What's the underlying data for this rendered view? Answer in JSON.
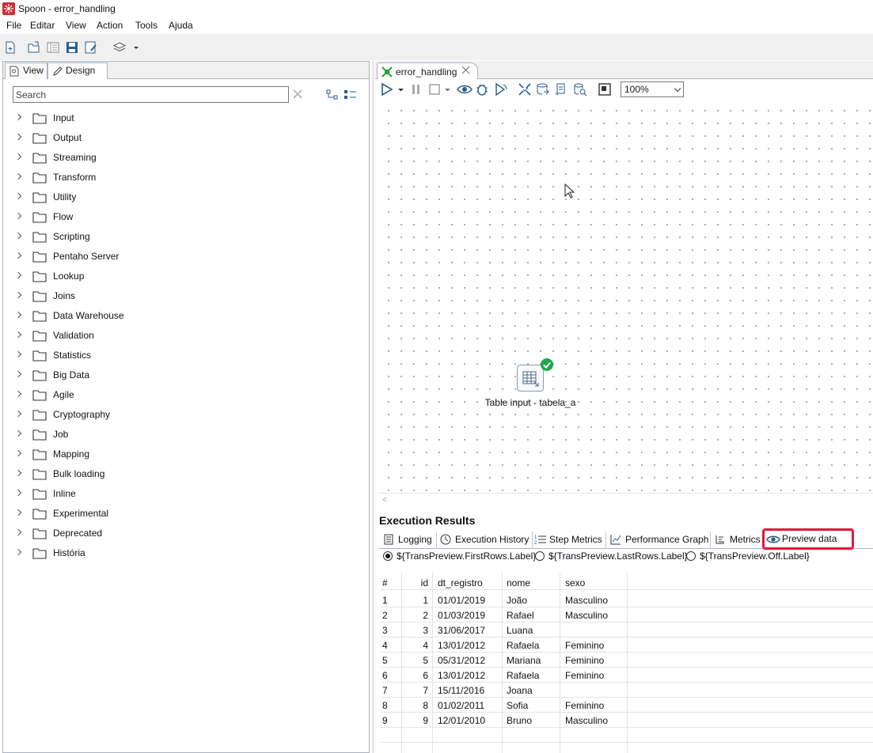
{
  "window": {
    "title": "Spoon - error_handling"
  },
  "menu": [
    "File",
    "Editar",
    "View",
    "Action",
    "Tools",
    "Ajuda"
  ],
  "left_panel": {
    "tabs": [
      "View",
      "Design"
    ],
    "search_placeholder": "Search",
    "tree": [
      "Input",
      "Output",
      "Streaming",
      "Transform",
      "Utility",
      "Flow",
      "Scripting",
      "Pentaho Server",
      "Lookup",
      "Joins",
      "Data Warehouse",
      "Validation",
      "Statistics",
      "Big Data",
      "Agile",
      "Cryptography",
      "Job",
      "Mapping",
      "Bulk loading",
      "Inline",
      "Experimental",
      "Deprecated",
      "História"
    ]
  },
  "editor": {
    "tab_label": "error_handling",
    "zoom": "100%",
    "step": {
      "label": "Table input - tabela_a",
      "status": "ok"
    }
  },
  "results": {
    "title": "Execution Results",
    "tabs": [
      "Logging",
      "Execution History",
      "Step Metrics",
      "Performance Graph",
      "Metrics",
      "Preview data"
    ],
    "active_tab": "Preview data",
    "radios": [
      {
        "label": "${TransPreview.FirstRows.Label}",
        "selected": true
      },
      {
        "label": "${TransPreview.LastRows.Label}",
        "selected": false
      },
      {
        "label": "${TransPreview.Off.Label}",
        "selected": false
      }
    ],
    "table": {
      "headers": [
        "#",
        "id",
        "dt_registro",
        "nome",
        "sexo"
      ],
      "rows": [
        [
          "1",
          "1",
          "01/01/2019",
          "João",
          "Masculino"
        ],
        [
          "2",
          "2",
          "01/03/2019",
          "Rafael",
          "Masculino"
        ],
        [
          "3",
          "3",
          "31/06/2017",
          "Luana",
          ""
        ],
        [
          "4",
          "4",
          "13/01/2012",
          "Rafaela",
          "Feminino"
        ],
        [
          "5",
          "5",
          "05/31/2012",
          "Mariana",
          "Feminino"
        ],
        [
          "6",
          "6",
          "13/01/2012",
          "Rafaela",
          "Feminino"
        ],
        [
          "7",
          "7",
          "15/11/2016",
          "Joana",
          ""
        ],
        [
          "8",
          "8",
          "01/02/2011",
          "Sofia",
          "Feminino"
        ],
        [
          "9",
          "9",
          "12/01/2010",
          "Bruno",
          "Masculino"
        ]
      ]
    }
  },
  "colors": {
    "accent_highlight": "#e2183e",
    "status_ok": "#1fa84a",
    "panel_border": "#a9b4c1",
    "app_icon": "#d7282f"
  }
}
